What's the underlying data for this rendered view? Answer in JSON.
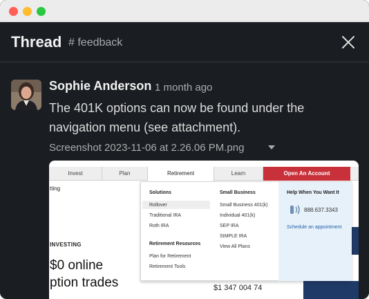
{
  "thread": {
    "title": "Thread",
    "channel": "# feedback"
  },
  "message": {
    "author": "Sophie Anderson",
    "time": "1 month ago",
    "text": "The 401K options can now be found under the navigation menu (see attachment).",
    "attachment_name": "Screenshot 2023-11-06 at 2.26.06 PM.png"
  },
  "attachment_preview": {
    "nav_tabs": [
      "Invest",
      "Plan",
      "Retirement",
      "Learn"
    ],
    "open_account": "Open An Account",
    "left_text_top": "tting",
    "investing": "INVESTING",
    "big_line_1": "$0 online",
    "big_line_2": "ption trades",
    "solutions_heading": "Solutions",
    "solutions": [
      "Rollover",
      "Traditional IRA",
      "Roth IRA"
    ],
    "resources_heading": "Retirement Resources",
    "resources": [
      "Plan for Retirement",
      "Retirement Tools"
    ],
    "small_business_heading": "Small Business",
    "small_business": [
      "Small Business 401(k)",
      "Individual 401(k)",
      "SEP IRA",
      "SIMPLE IRA",
      "View All Plans"
    ],
    "help_heading": "Help When You Want It",
    "phone": "888.637.3343",
    "schedule": "Schedule an appointment",
    "bottom_number": "$1 347 004 74"
  },
  "colors": {
    "background": "#1a1d21",
    "open_account": "#c8313a",
    "link": "#1d5fa8"
  }
}
